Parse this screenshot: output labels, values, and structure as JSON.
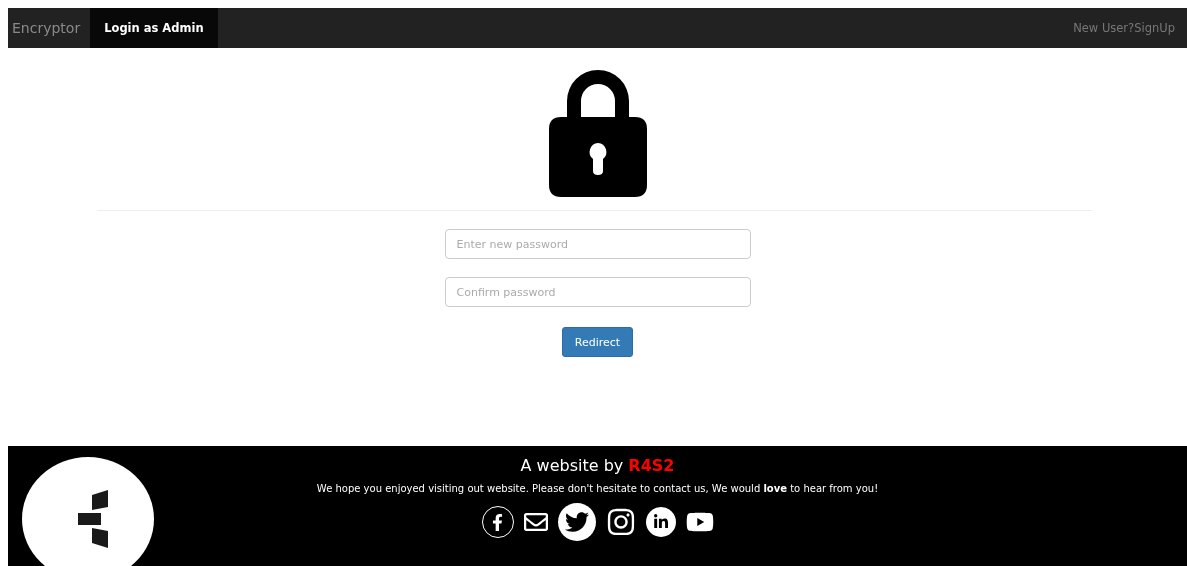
{
  "navbar": {
    "brand": "Encryptor",
    "tabs": [
      {
        "label": "Login as Admin",
        "selected": true
      }
    ],
    "right_link": "New User?SignUp"
  },
  "form": {
    "fields": [
      {
        "placeholder": "Enter new password"
      },
      {
        "placeholder": "Confirm password"
      }
    ],
    "button": "Redirect"
  },
  "footer": {
    "title": "A website by",
    "brand": "R4S2",
    "message": "We hope you enjoyed visiting out website. Please don't hesitate to contact us, We would **love** to hear from you!",
    "social": [
      {
        "kind": "facebook"
      },
      {
        "kind": "mail"
      },
      {
        "kind": "twitter"
      },
      {
        "kind": "instagram"
      },
      {
        "kind": "linkedin"
      },
      {
        "kind": "youtube"
      }
    ]
  }
}
